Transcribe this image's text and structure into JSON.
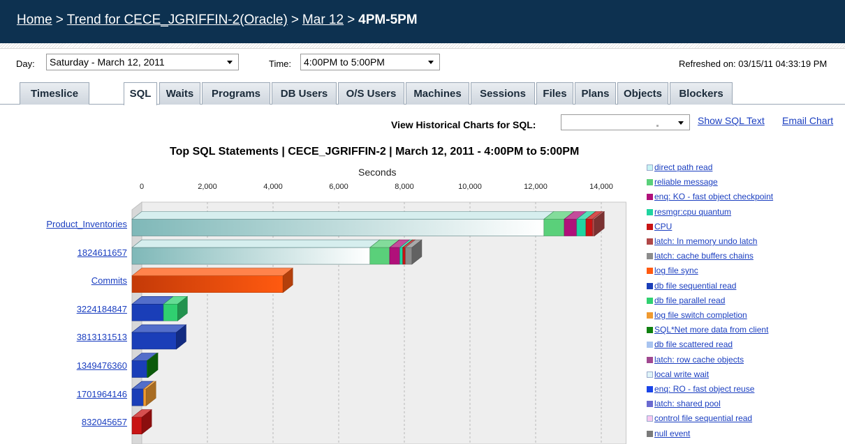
{
  "breadcrumb": {
    "home": "Home",
    "trend": "Trend for CECE_JGRIFFIN-2(Oracle)",
    "day": "Mar 12",
    "current": "4PM-5PM",
    "separator": ">"
  },
  "controls": {
    "day_label": "Day:",
    "day_value": "Saturday - March 12, 2011",
    "time_label": "Time:",
    "time_value": "4:00PM to 5:00PM",
    "refreshed": "Refreshed on: 03/15/11 04:33:19 PM"
  },
  "tabs": [
    {
      "label": "Timeslice",
      "active": false
    },
    {
      "label": "SQL",
      "active": true
    },
    {
      "label": "Waits",
      "active": false
    },
    {
      "label": "Programs",
      "active": false
    },
    {
      "label": "DB Users",
      "active": false
    },
    {
      "label": "O/S Users",
      "active": false
    },
    {
      "label": "Machines",
      "active": false
    },
    {
      "label": "Sessions",
      "active": false
    },
    {
      "label": "Files",
      "active": false
    },
    {
      "label": "Plans",
      "active": false
    },
    {
      "label": "Objects",
      "active": false
    },
    {
      "label": "Blockers",
      "active": false
    }
  ],
  "historical": {
    "label": "View Historical Charts for SQL:",
    "value": "",
    "show_sql": "Show SQL Text",
    "email": "Email Chart"
  },
  "chart_data": {
    "type": "bar",
    "orientation": "horizontal",
    "stacked": true,
    "title": "Top SQL Statements  |  CECE_JGRIFFIN-2  |  March 12, 2011 - 4:00PM to 5:00PM",
    "xlabel": "Seconds",
    "xlim": [
      0,
      14500
    ],
    "xticks": [
      "0",
      "2,000",
      "4,000",
      "6,000",
      "8,000",
      "10,000",
      "12,000",
      "14,000"
    ],
    "grid": true,
    "legend_position": "right",
    "categories": [
      "Product_Inventories",
      "1824611657",
      "Commits",
      "3224184847",
      "3813131513",
      "1349476360",
      "1701964146",
      "832045657"
    ],
    "bars": [
      {
        "category": "Product_Inventories",
        "segments": [
          {
            "wait": "direct path read",
            "value": 12550
          },
          {
            "wait": "reliable message",
            "value": 620
          },
          {
            "wait": "enq: KO - fast object checkpoint",
            "value": 380
          },
          {
            "wait": "resmgr:cpu quantum",
            "value": 280
          },
          {
            "wait": "CPU",
            "value": 200
          },
          {
            "wait": "latch: In memory undo latch",
            "value": 60
          }
        ]
      },
      {
        "category": "1824611657",
        "segments": [
          {
            "wait": "direct path read",
            "value": 7250
          },
          {
            "wait": "reliable message",
            "value": 600
          },
          {
            "wait": "enq: KO - fast object checkpoint",
            "value": 310
          },
          {
            "wait": "resmgr:cpu quantum",
            "value": 90
          },
          {
            "wait": "CPU",
            "value": 80
          },
          {
            "wait": "latch: cache buffers chains",
            "value": 200
          }
        ]
      },
      {
        "category": "Commits",
        "segments": [
          {
            "wait": "log file sync",
            "value": 4600
          }
        ]
      },
      {
        "category": "3224184847",
        "segments": [
          {
            "wait": "db file sequential read",
            "value": 960
          },
          {
            "wait": "db file parallel read",
            "value": 430
          }
        ]
      },
      {
        "category": "3813131513",
        "segments": [
          {
            "wait": "db file sequential read",
            "value": 1350
          }
        ]
      },
      {
        "category": "1349476360",
        "segments": [
          {
            "wait": "db file sequential read",
            "value": 460
          },
          {
            "wait": "SQL*Net more data from client",
            "value": 30
          }
        ]
      },
      {
        "category": "1701964146",
        "segments": [
          {
            "wait": "db file sequential read",
            "value": 350
          },
          {
            "wait": "log file switch completion",
            "value": 80
          }
        ]
      },
      {
        "category": "832045657",
        "segments": [
          {
            "wait": "CPU",
            "value": 300
          }
        ]
      }
    ],
    "legend": [
      {
        "label": "direct path read",
        "color": "#c8f4f4"
      },
      {
        "label": "reliable message",
        "color": "#5ad07a"
      },
      {
        "label": "enq: KO - fast object checkpoint",
        "color": "#b0107a"
      },
      {
        "label": "resmgr:cpu quantum",
        "color": "#20d4a0"
      },
      {
        "label": "CPU",
        "color": "#c81414"
      },
      {
        "label": "latch: In memory undo latch",
        "color": "#b04848"
      },
      {
        "label": "latch: cache buffers chains",
        "color": "#8c8c8c"
      },
      {
        "label": "log file sync",
        "color": "#ff5a10"
      },
      {
        "label": "db file sequential read",
        "color": "#1a3eb8"
      },
      {
        "label": "db file parallel read",
        "color": "#30d070"
      },
      {
        "label": "log file switch completion",
        "color": "#f09a30"
      },
      {
        "label": "SQL*Net more data from client",
        "color": "#108010"
      },
      {
        "label": "db file scattered read",
        "color": "#a8c4f0"
      },
      {
        "label": "latch: row cache objects",
        "color": "#a04890"
      },
      {
        "label": "local write wait",
        "color": "#e0f4f8"
      },
      {
        "label": "enq: RO - fast object reuse",
        "color": "#1a44e8"
      },
      {
        "label": "latch: shared pool",
        "color": "#6a6ad0"
      },
      {
        "label": "control file sequential read",
        "color": "#f8c8f0"
      },
      {
        "label": "null event",
        "color": "#7a7a7a"
      }
    ]
  }
}
